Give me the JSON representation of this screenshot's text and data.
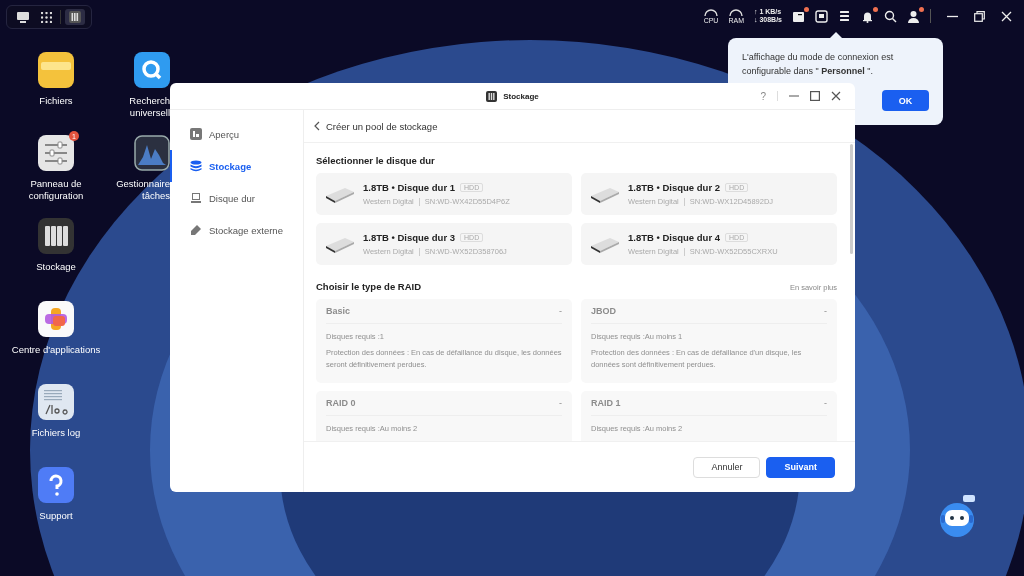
{
  "taskbar": {
    "apps": [
      {
        "kind": "desktop",
        "selected": false
      },
      {
        "kind": "apps",
        "selected": false
      },
      {
        "kind": "storage",
        "selected": true
      }
    ]
  },
  "tray": {
    "cpu": "CPU",
    "ram": "RAM",
    "upload": "↑ 1 KB/s",
    "download": "↓ 308B/s",
    "icons": [
      {
        "kind": "news",
        "dot": true
      },
      {
        "kind": "monitor",
        "dot": false
      },
      {
        "kind": "list",
        "dot": false
      },
      {
        "kind": "bell",
        "dot": true
      },
      {
        "kind": "search",
        "dot": false
      },
      {
        "kind": "user",
        "dot": true
      }
    ]
  },
  "desktop_icons": [
    {
      "kind": "folder",
      "label": "Fichiers"
    },
    {
      "kind": "search",
      "label": "Recherch\nuniversell"
    },
    {
      "kind": "control",
      "label": "Panneau de\nconfiguration",
      "badge": "1"
    },
    {
      "kind": "monitor",
      "label": "Gestionnaire\ntâches"
    },
    {
      "kind": "storage",
      "label": "Stockage"
    },
    {
      "kind": "apps",
      "label": "Centre d'applications"
    },
    {
      "kind": "logs",
      "label": "Fichiers log"
    },
    {
      "kind": "help",
      "label": "Support"
    }
  ],
  "popover": {
    "text": "L'affichage du mode de connexion est configurable dans \" **Personnel** \".",
    "button": "OK"
  },
  "window": {
    "title": "Stockage",
    "help": "?",
    "sidebar": [
      {
        "kind": "overview",
        "label": "Aperçu",
        "selected": false
      },
      {
        "kind": "storage",
        "label": "Stockage",
        "selected": true
      },
      {
        "kind": "disk",
        "label": "Disque dur",
        "selected": false
      },
      {
        "kind": "external",
        "label": "Stockage externe",
        "selected": false
      }
    ],
    "page_title": "Créer un pool de stockage",
    "disk_section": "Sélectionner le disque dur",
    "disks": [
      {
        "name": "1.8TB • Disque dur 1",
        "type": "HDD",
        "vendor": "Western Digital",
        "serial": "SN:WD-WX42D55D4P6Z",
        "selected": false
      },
      {
        "name": "1.8TB • Disque dur 2",
        "type": "HDD",
        "vendor": "Western Digital",
        "serial": "SN:WD-WX12D45892DJ",
        "selected": false
      },
      {
        "name": "1.8TB • Disque dur 3",
        "type": "HDD",
        "vendor": "Western Digital",
        "serial": "SN:WD-WX52D358706J",
        "selected": false
      },
      {
        "name": "1.8TB • Disque dur 4",
        "type": "HDD",
        "vendor": "Western Digital",
        "serial": "SN:WD-WX52D55CXRXU",
        "selected": false
      }
    ],
    "raid_section": "Choisir le type de RAID",
    "learn_more": "En savoir plus",
    "raid_types": [
      {
        "name": "Basic",
        "mark": "-",
        "disabled": true,
        "required": "Disques requis :1",
        "protection": "Protection des données :  En cas de défaillance du disque, les données seront définitivement perdues."
      },
      {
        "name": "JBOD",
        "mark": "-",
        "disabled": true,
        "required": "Disques requis :Au moins 1",
        "protection": "Protection des données :  En cas de défaillance d'un disque, les données sont définitivement perdues."
      },
      {
        "name": "RAID 0",
        "mark": "-",
        "disabled": true,
        "required": "Disques requis :Au moins 2"
      },
      {
        "name": "RAID 1",
        "mark": "-",
        "disabled": true,
        "required": "Disques requis :Au moins 2"
      }
    ],
    "buttons": [
      {
        "kind": "secondary",
        "label": "Annuler"
      },
      {
        "kind": "primary",
        "label": "Suivant"
      }
    ]
  }
}
